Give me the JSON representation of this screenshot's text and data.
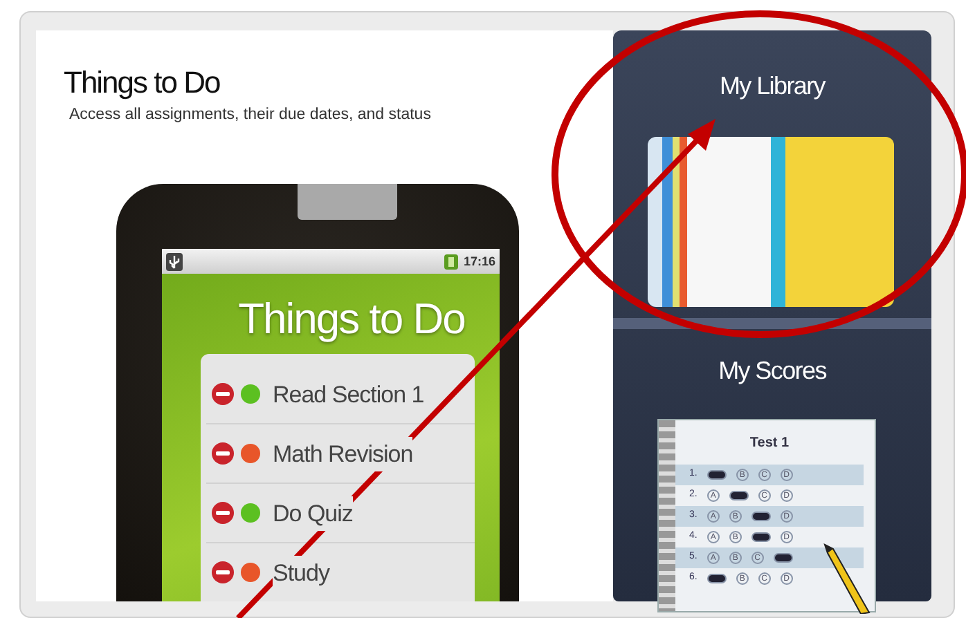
{
  "page": {
    "title": "Things to Do",
    "subtitle": "Access all assignments, their due dates, and status"
  },
  "device": {
    "time": "17:16",
    "app_title": "Things to Do",
    "tasks": [
      {
        "label": "Read Section 1",
        "color": "#5cc021"
      },
      {
        "label": "Math Revision",
        "color": "#e8562a"
      },
      {
        "label": "Do Quiz",
        "color": "#5cc021"
      },
      {
        "label": "Study",
        "color": "#e8562a"
      }
    ]
  },
  "side_panels": [
    {
      "kind": "library",
      "title": "My Library"
    },
    {
      "kind": "scores",
      "title": "My Scores",
      "test_sheet": {
        "title": "Test 1",
        "rows": [
          {
            "number": "1.",
            "choices": [
              {
                "selected": true
              },
              {
                "label": "B",
                "selected": false
              },
              {
                "label": "C",
                "selected": false
              },
              {
                "label": "D",
                "selected": false
              }
            ]
          },
          {
            "number": "2.",
            "choices": [
              {
                "label": "A",
                "selected": false
              },
              {
                "selected": true
              },
              {
                "label": "C",
                "selected": false
              },
              {
                "label": "D",
                "selected": false
              }
            ]
          },
          {
            "number": "3.",
            "choices": [
              {
                "label": "A",
                "selected": false
              },
              {
                "label": "B",
                "selected": false
              },
              {
                "selected": true
              },
              {
                "label": "D",
                "selected": false
              }
            ]
          },
          {
            "number": "4.",
            "choices": [
              {
                "label": "A",
                "selected": false
              },
              {
                "label": "B",
                "selected": false
              },
              {
                "selected": true
              },
              {
                "label": "D",
                "selected": false
              }
            ]
          },
          {
            "number": "5.",
            "choices": [
              {
                "label": "A",
                "selected": false
              },
              {
                "label": "B",
                "selected": false
              },
              {
                "label": "C",
                "selected": false
              },
              {
                "selected": true
              }
            ]
          },
          {
            "number": "6.",
            "choices": [
              {
                "selected": true
              },
              {
                "label": "B",
                "selected": false
              },
              {
                "label": "C",
                "selected": false
              },
              {
                "label": "D",
                "selected": false
              }
            ]
          }
        ]
      }
    }
  ]
}
